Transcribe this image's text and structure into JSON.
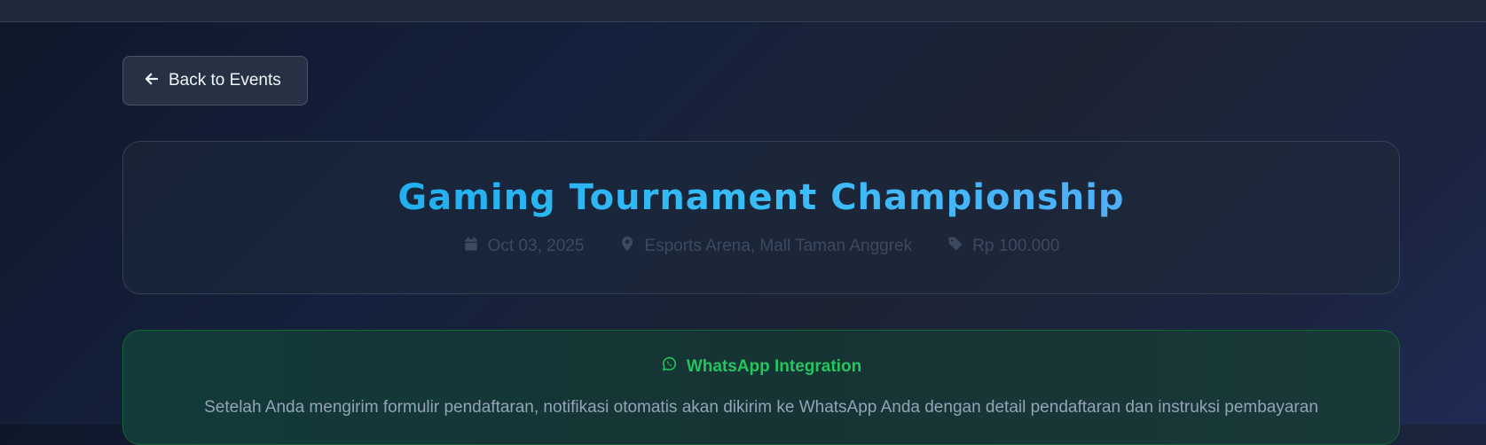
{
  "back_button": {
    "label": "Back to Events",
    "icon": "arrow-left-icon"
  },
  "event": {
    "title": "Gaming Tournament Championship",
    "date": "Oct 03, 2025",
    "location": "Esports Arena, Mall Taman Anggrek",
    "price": "Rp 100.000",
    "icons": {
      "date": "calendar-icon",
      "location": "map-pin-icon",
      "price": "tag-icon"
    },
    "title_gradient": [
      "#0ea5e9",
      "#60a5fa"
    ]
  },
  "whatsapp": {
    "title": "WhatsApp Integration",
    "description": "Setelah Anda mengirim formulir pendaftaran, notifikasi otomatis akan dikirim ke WhatsApp Anda dengan detail pendaftaran dan instruksi pembayaran",
    "icon": "whatsapp-icon",
    "accent": "#22c55e"
  }
}
